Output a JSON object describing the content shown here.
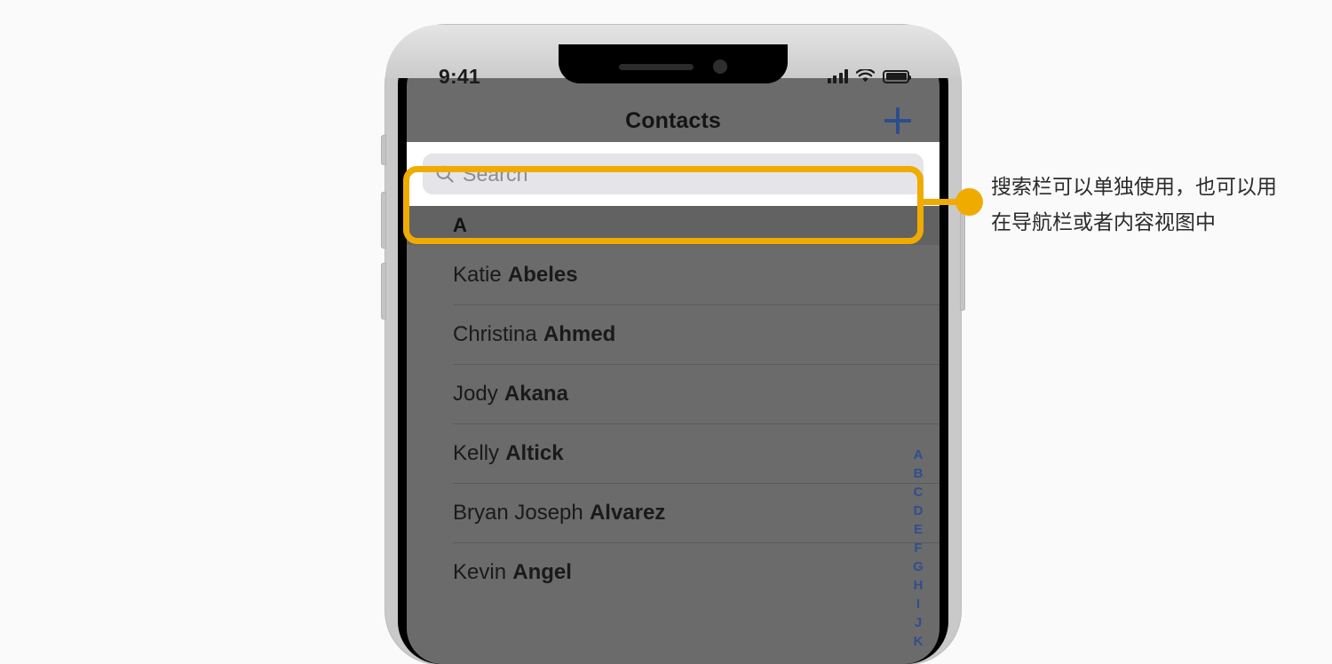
{
  "colors": {
    "accent_orange": "#f0ab00",
    "link_blue": "#2a4d8f",
    "index_blue": "#2f4f8c",
    "page_background": "#fafafa",
    "phone_frame": "#c9c9c9",
    "screen_dimmed": "#6b6b6b",
    "search_field": "#e4e4e9"
  },
  "status_bar": {
    "time": "9:41",
    "cellular_icon": "signal-bars-icon",
    "wifi_icon": "wifi-icon",
    "battery_icon": "battery-icon"
  },
  "nav_bar": {
    "title": "Contacts",
    "add_button_icon": "plus-icon"
  },
  "search": {
    "placeholder": "Search",
    "value": "",
    "icon": "search-icon"
  },
  "list": {
    "section_header": "A",
    "contacts": [
      {
        "given": "Katie",
        "family": "Abeles"
      },
      {
        "given": "Christina",
        "family": "Ahmed"
      },
      {
        "given": "Jody",
        "family": "Akana"
      },
      {
        "given": "Kelly",
        "family": "Altick"
      },
      {
        "given": "Bryan Joseph",
        "family": "Alvarez"
      },
      {
        "given": "Kevin",
        "family": "Angel"
      }
    ]
  },
  "index_strip": {
    "letters": [
      "A",
      "B",
      "C",
      "D",
      "E",
      "F",
      "G",
      "H",
      "I",
      "J",
      "K"
    ]
  },
  "callout": {
    "text": "搜索栏可以单独使用，也可以用在导航栏或者内容视图中"
  }
}
